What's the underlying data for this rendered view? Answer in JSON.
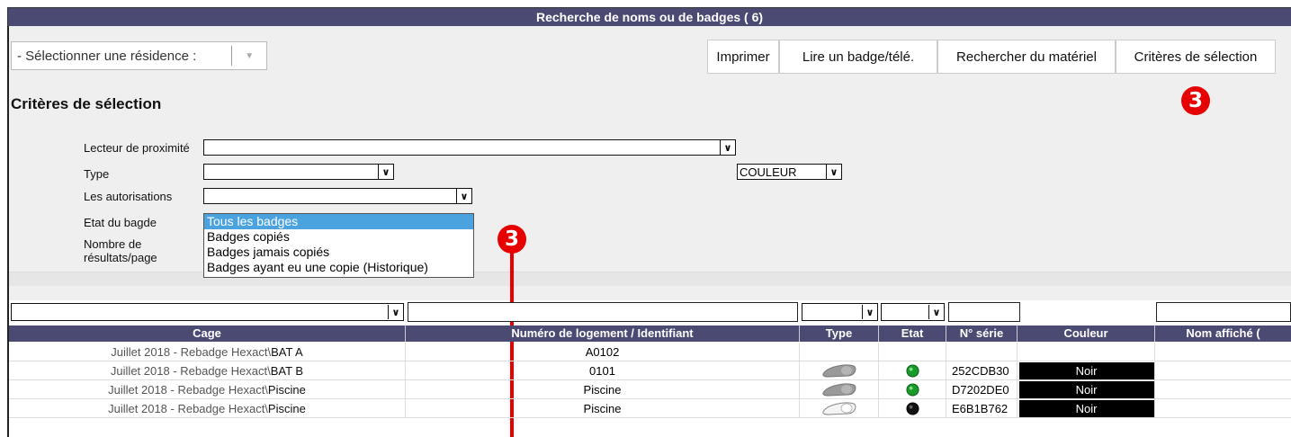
{
  "window": {
    "title": "Recherche de noms ou de badges ( 6)"
  },
  "residence": {
    "label": "- Sélectionner une résidence :"
  },
  "toolbar": {
    "print_label": "Imprimer",
    "read_label": "Lire un badge/télé.",
    "search_material_label": "Rechercher du matériel",
    "criteria_label": "Critères de sélection"
  },
  "annotations": {
    "callout_number": "3",
    "callout_color": "#e60000"
  },
  "criteria": {
    "title": "Critères de sélection",
    "reader_label": "Lecteur de proximité",
    "reader_value": "",
    "type_label": "Type",
    "type_value": "",
    "color_value": "COULEUR",
    "auth_label": "Les autorisations",
    "auth_value": "",
    "state_label": "Etat du bagde",
    "results_label_1": "Nombre de",
    "results_label_2": "résultats/page",
    "state_options": [
      "Tous les badges",
      "Badges copiés",
      "Badges jamais copiés",
      "Badges ayant eu une copie (Historique)"
    ]
  },
  "table": {
    "headers": {
      "cage": "Cage",
      "number": "Numéro de logement / Identifiant",
      "type": "Type",
      "state": "Etat",
      "serial": "N° série",
      "color": "Couleur",
      "name": "Nom affiché ("
    },
    "rows": [
      {
        "cage_prefix": "Juillet 2018 - Rebadge Hexact\\",
        "cage_name": "BAT A",
        "number": "A0102",
        "type_icon": "none",
        "state_icon": "none",
        "serial": "",
        "color": ""
      },
      {
        "cage_prefix": "Juillet 2018 - Rebadge Hexact\\",
        "cage_name": "BAT B",
        "number": "0101",
        "type_icon": "grey-badge-icon",
        "state_icon": "green-status-icon",
        "serial": "252CDB30",
        "color": "Noir"
      },
      {
        "cage_prefix": "Juillet 2018 - Rebadge Hexact\\",
        "cage_name": "Piscine",
        "number": "Piscine",
        "type_icon": "grey-badge-icon",
        "state_icon": "green-status-icon",
        "serial": "D7202DE0",
        "color": "Noir"
      },
      {
        "cage_prefix": "Juillet 2018 - Rebadge Hexact\\",
        "cage_name": "Piscine",
        "number": "Piscine",
        "type_icon": "white-badge-icon",
        "state_icon": "black-status-icon",
        "serial": "E6B1B762",
        "color": "Noir"
      }
    ]
  },
  "colors": {
    "header_bg": "#4a4a73",
    "selected_option": "#4aa3df"
  }
}
